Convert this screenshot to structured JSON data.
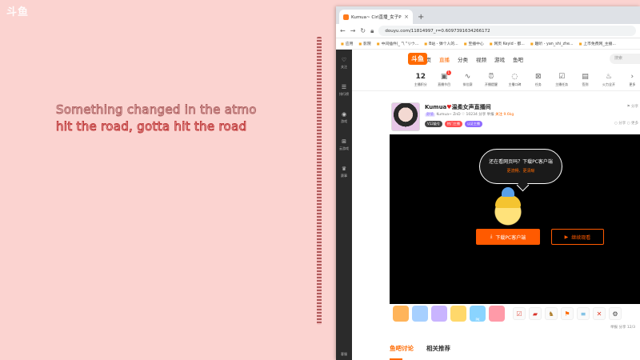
{
  "overlay": {
    "watermark": "斗鱼",
    "lyric_line_1": "Something changed in the atmo",
    "lyric_line_2": "hit the road, gotta hit the road"
  },
  "browser": {
    "tab_title": "Kumua~ Cirl直播_女子PK弹_9",
    "tab_close": "×",
    "new_tab": "+",
    "url": "douyu.com/11814997_r=0.6097391634266172",
    "bookmarks": [
      "应用",
      "影院",
      "中间插件(_ \"\\ \"リウ...",
      "B站 - 弹个人的...",
      "至播中心",
      "网页 Keyid - 都...",
      "趣听 - yan_shi_zhe...",
      "上市免费网_主播..."
    ]
  },
  "site": {
    "logo": "斗鱼",
    "nav": [
      "首页",
      "直播",
      "分类",
      "视频",
      "游戏",
      "鱼吧"
    ],
    "active_nav": "直播",
    "search_placeholder": "搜索"
  },
  "left_sidebar": {
    "items": [
      "关注",
      "排行榜",
      "游戏",
      "云游戏",
      "赛事"
    ],
    "bottom": "客服"
  },
  "categories": {
    "first_number": "12",
    "first_label": "主播积分",
    "first_badge": "1",
    "items": [
      "直播节目",
      "排位赛",
      "开播提醒",
      "主播口碑",
      "任务",
      "主播任务",
      "签到",
      "火力全开",
      "更多"
    ]
  },
  "room": {
    "host_name": "Kumua",
    "host_suffix": "温柔女声直播间",
    "tag": "颜值",
    "meta": "Kumua~ ZnD  ♡ 10234  分享 举报",
    "follow": "关注 9.6kg",
    "pills": [
      "V12级号",
      "热门主播",
      "认证主播"
    ],
    "right_top": "⚑ 分享",
    "right_bottom": "○ 分享  ○ 更多"
  },
  "player": {
    "bubble_text": "还在看网页吗？下载PC客户端",
    "bubble_sub": "更流畅、更清晰",
    "download_button": "下载PC客户端",
    "watch_button": "继续观看"
  },
  "gifts": {
    "labels": [
      "",
      "",
      "",
      "",
      "PK",
      ""
    ],
    "subinfo": "举报  分享 12/3"
  },
  "lower_tabs": [
    "鱼吧讨论",
    "相关推荐"
  ],
  "colors": {
    "accent": "#ff6a00",
    "background_pink": "#fbd3d0",
    "sidebar_dark": "#2b2b2b"
  }
}
